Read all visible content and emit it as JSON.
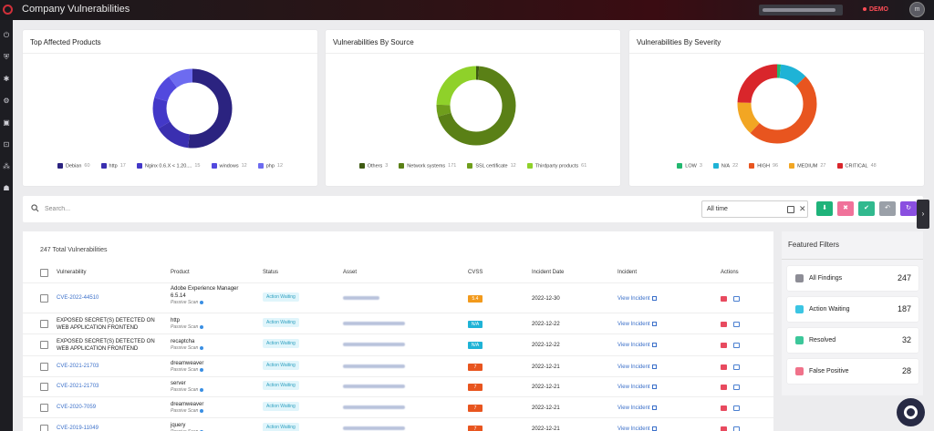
{
  "header": {
    "title": "Company Vulnerabilities",
    "badge": "DEMO",
    "avatar_initials": "m",
    "logo_icon": "ring-logo-icon"
  },
  "sidebar": {
    "items": [
      {
        "icon": "power-icon",
        "glyph": "⏻"
      },
      {
        "icon": "shield-icon",
        "glyph": "⛨"
      },
      {
        "icon": "bug-icon",
        "glyph": "✱"
      },
      {
        "icon": "gear-shield-icon",
        "glyph": "⚙"
      },
      {
        "icon": "monitor-icon",
        "glyph": "▣"
      },
      {
        "icon": "lock-icon",
        "glyph": "⊡"
      },
      {
        "icon": "network-icon",
        "glyph": "⁂"
      },
      {
        "icon": "spy-icon",
        "glyph": "☗"
      }
    ]
  },
  "cards": [
    {
      "title": "Top Affected Products",
      "legend": [
        {
          "label": "Debian",
          "count": "60",
          "color": "#2b2380"
        },
        {
          "label": "http",
          "count": "17",
          "color": "#3a2fb0"
        },
        {
          "label": "Nginx 0.6.X < 1.20....",
          "count": "15",
          "color": "#4338c8"
        },
        {
          "label": "windows",
          "count": "12",
          "color": "#5249de"
        },
        {
          "label": "php",
          "count": "12",
          "color": "#6d6bf0"
        }
      ]
    },
    {
      "title": "Vulnerabilities By Source",
      "legend": [
        {
          "label": "Others",
          "count": "3",
          "color": "#3e5a12"
        },
        {
          "label": "Network systems",
          "count": "171",
          "color": "#5a8016"
        },
        {
          "label": "SSL certificate",
          "count": "12",
          "color": "#6f9e1c"
        },
        {
          "label": "Thirdparty products",
          "count": "61",
          "color": "#8fd12a"
        }
      ]
    },
    {
      "title": "Vulnerabilities By Severity",
      "legend": [
        {
          "label": "LOW",
          "count": "3",
          "color": "#22b86f"
        },
        {
          "label": "N/A",
          "count": "22",
          "color": "#1fb3d6"
        },
        {
          "label": "HIGH",
          "count": "96",
          "color": "#e8551f"
        },
        {
          "label": "MEDIUM",
          "count": "27",
          "color": "#f2a623"
        },
        {
          "label": "CRITICAL",
          "count": "48",
          "color": "#d9262b"
        }
      ]
    }
  ],
  "search": {
    "placeholder": "Search...",
    "time_range": "All time"
  },
  "toolbar_buttons": [
    {
      "icon": "download-icon",
      "glyph": "⬇",
      "color": "#1fb37a"
    },
    {
      "icon": "thumb-down-icon",
      "glyph": "✖",
      "color": "#f0729a"
    },
    {
      "icon": "check-icon",
      "glyph": "✔",
      "color": "#31b98e"
    },
    {
      "icon": "undo-icon",
      "glyph": "↶",
      "color": "#9aa0a8"
    },
    {
      "icon": "refresh-icon",
      "glyph": "↻",
      "color": "#8a4fe0"
    }
  ],
  "table": {
    "total_label": "247 Total Vulnerabilities",
    "columns": [
      "Vulnerability",
      "Product",
      "Status",
      "Asset",
      "CVSS",
      "Incident Date",
      "Incident",
      "Actions"
    ],
    "rows": [
      {
        "vuln": "CVE-2022-44510",
        "vuln_is_link": true,
        "product": "Adobe Experience Manager 6.5.14",
        "scan": "Passive Scan",
        "status": "Action Waiting",
        "cvss": "5.4",
        "cvss_color": "#f29a1c",
        "date": "2022-12-30",
        "incident": "View Incident"
      },
      {
        "vuln": "EXPOSED SECRET(S) DETECTED ON WEB APPLICATION FRONTEND",
        "vuln_is_link": false,
        "product": "http",
        "scan": "Passive Scan",
        "status": "Action Waiting",
        "cvss": "N/A",
        "cvss_color": "#1fb3d6",
        "date": "2022-12-22",
        "incident": "View Incident"
      },
      {
        "vuln": "EXPOSED SECRET(S) DETECTED ON WEB APPLICATION FRONTEND",
        "vuln_is_link": false,
        "product": "recaptcha",
        "scan": "Passive Scan",
        "status": "Action Waiting",
        "cvss": "N/A",
        "cvss_color": "#1fb3d6",
        "date": "2022-12-22",
        "incident": "View Incident"
      },
      {
        "vuln": "CVE-2021-21703",
        "vuln_is_link": true,
        "product": "dreamweaver",
        "scan": "Passive Scan",
        "status": "Action Waiting",
        "cvss": "7",
        "cvss_color": "#e8551f",
        "date": "2022-12-21",
        "incident": "View Incident"
      },
      {
        "vuln": "CVE-2021-21703",
        "vuln_is_link": true,
        "product": "server",
        "scan": "Passive Scan",
        "status": "Action Waiting",
        "cvss": "7",
        "cvss_color": "#e8551f",
        "date": "2022-12-21",
        "incident": "View Incident"
      },
      {
        "vuln": "CVE-2020-7059",
        "vuln_is_link": true,
        "product": "dreamweaver",
        "scan": "Passive Scan",
        "status": "Action Waiting",
        "cvss": "7",
        "cvss_color": "#e8551f",
        "date": "2022-12-21",
        "incident": "View Incident"
      },
      {
        "vuln": "CVE-2019-11049",
        "vuln_is_link": true,
        "product": "jquery",
        "scan": "Passive Scan",
        "status": "Action Waiting",
        "cvss": "7",
        "cvss_color": "#e8551f",
        "date": "2022-12-21",
        "incident": "View Incident"
      }
    ]
  },
  "featured_filters": {
    "title": "Featured Filters",
    "items": [
      {
        "label": "All Findings",
        "count": "247",
        "color": "#8d8d96"
      },
      {
        "label": "Action Waiting",
        "count": "187",
        "color": "#3cc5e3"
      },
      {
        "label": "Resolved",
        "count": "32",
        "color": "#3cc79a"
      },
      {
        "label": "False Positive",
        "count": "28",
        "color": "#f0728a"
      }
    ]
  },
  "help_button_icon": "lifebuoy-icon"
}
